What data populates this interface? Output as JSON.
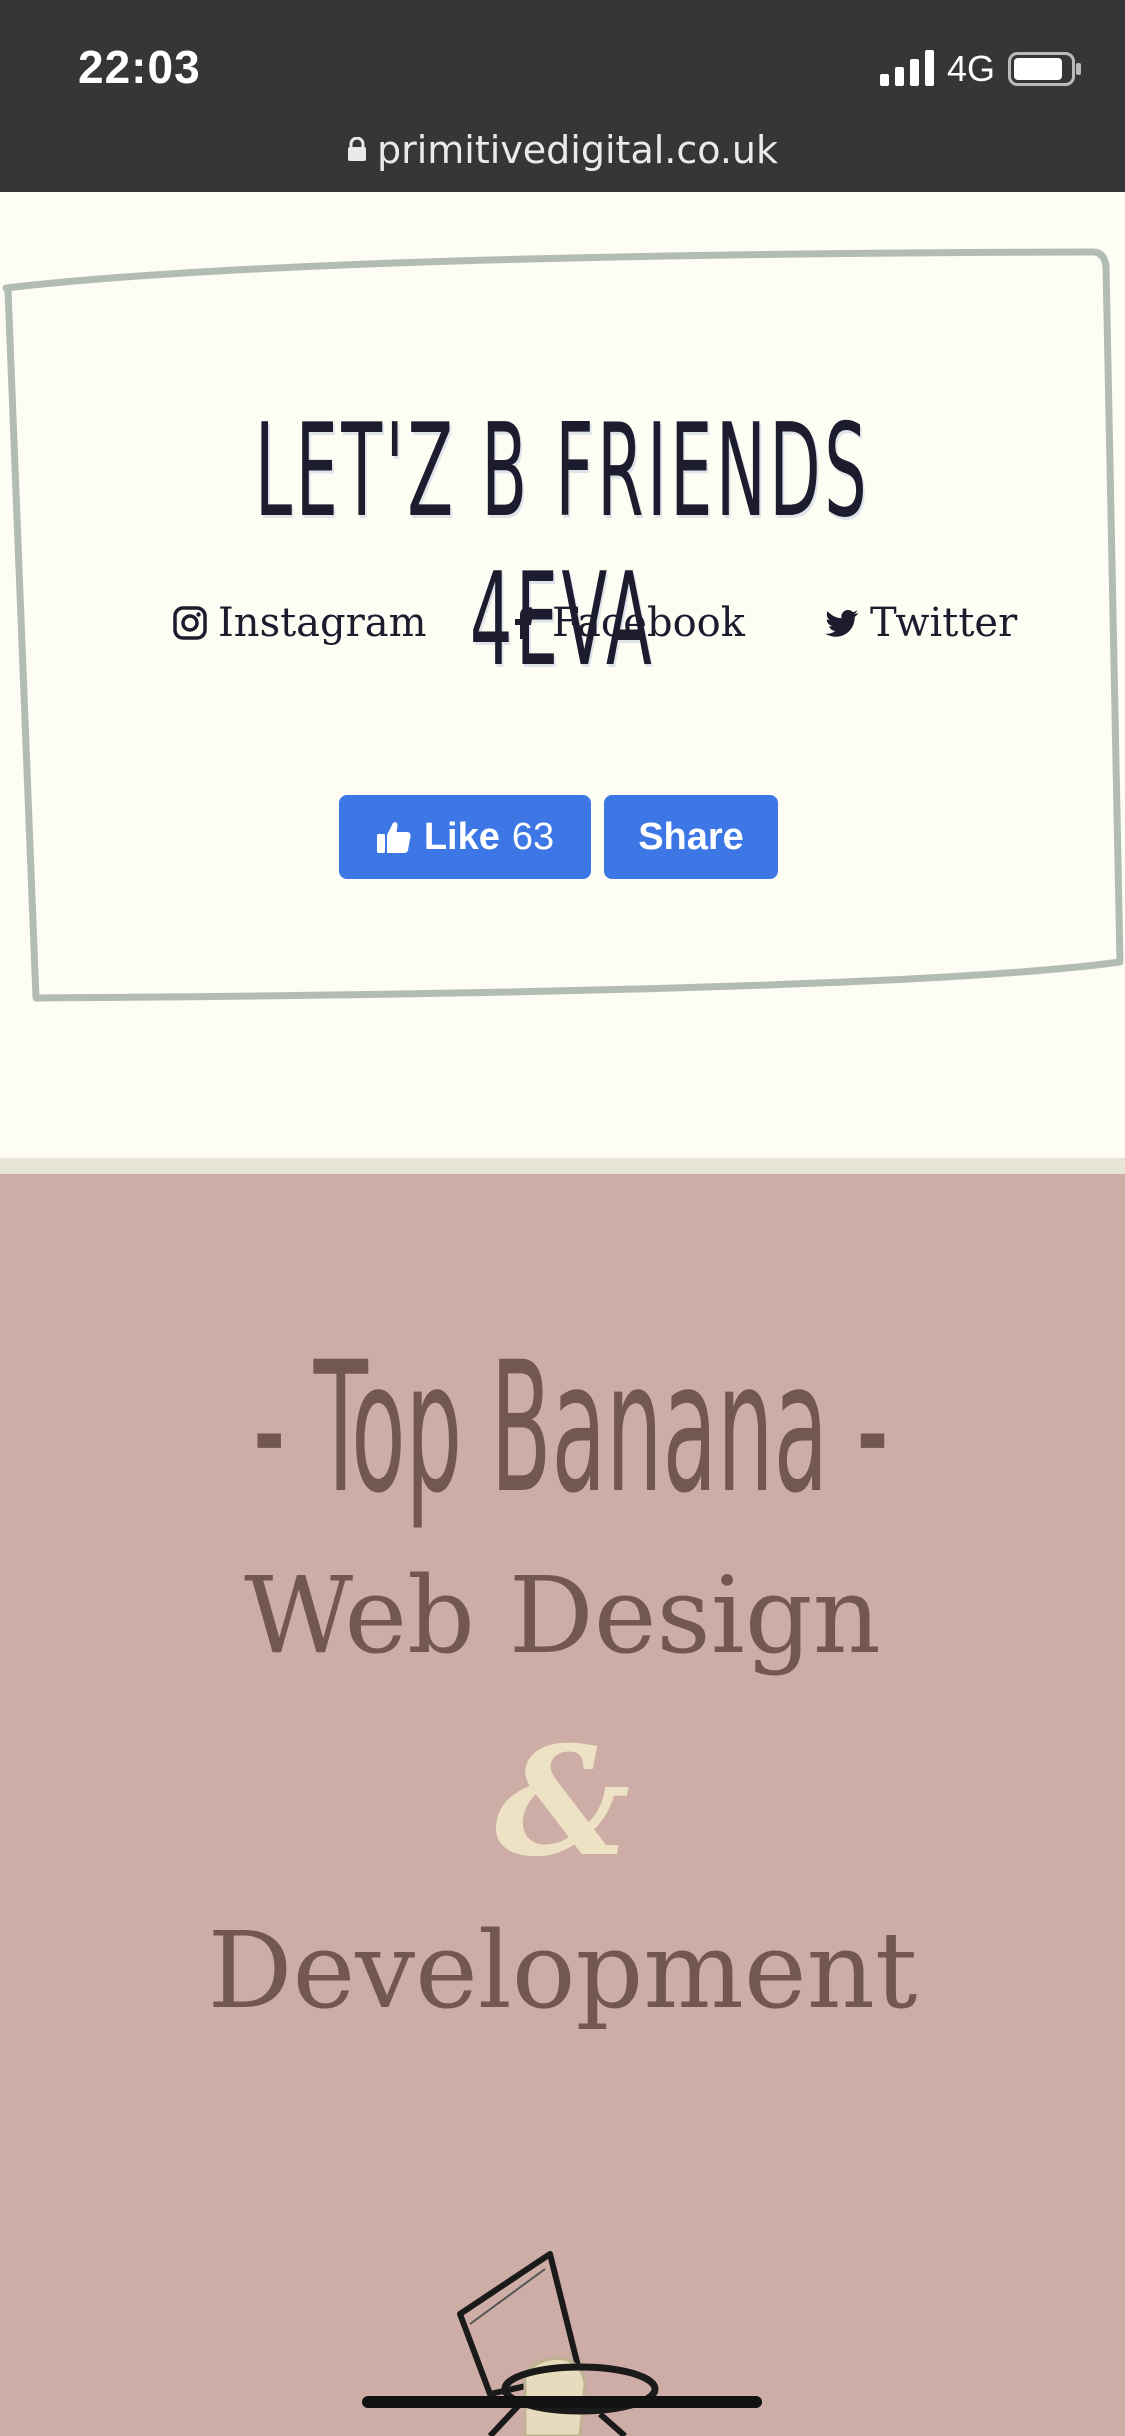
{
  "status_bar": {
    "time": "22:03",
    "network": "4G"
  },
  "browser": {
    "url": "primitivedigital.co.uk"
  },
  "friends": {
    "heading": "LET'Z B FRIENDS 4EVA",
    "links": [
      {
        "label": "Instagram",
        "icon": "instagram-icon"
      },
      {
        "label": "Facebook",
        "icon": "facebook-icon"
      },
      {
        "label": "Twitter",
        "icon": "twitter-icon"
      }
    ],
    "like_label": "Like",
    "like_count": "63",
    "share_label": "Share"
  },
  "hero": {
    "title": "- Top Banana -",
    "line1": "Web Design",
    "ampersand": "&",
    "line2": "Development"
  },
  "colors": {
    "status_bg": "#353638",
    "page_bg": "#fdfdf3",
    "frame": "#b2bcb4",
    "facebook_blue": "#3c77e5",
    "hero_bg": "#cdada6",
    "hero_text": "#735850",
    "ampersand": "#ede2c4"
  }
}
